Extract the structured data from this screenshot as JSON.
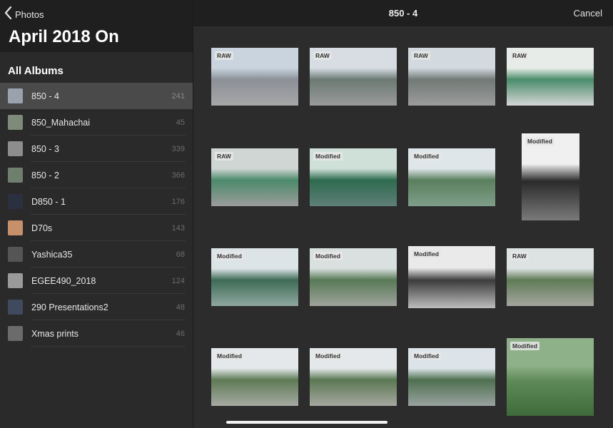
{
  "nav": {
    "back_label": "Photos",
    "album_title": "April 2018 On",
    "section_title": "All Albums"
  },
  "albums": [
    {
      "name": "850 - 4",
      "count": "241",
      "selected": true,
      "thumb_color": "#9aa3ad"
    },
    {
      "name": "850_Mahachai",
      "count": "45",
      "thumb_color": "#7f8b7a"
    },
    {
      "name": "850 - 3",
      "count": "339",
      "thumb_color": "#8d8d8d"
    },
    {
      "name": "850 - 2",
      "count": "366",
      "thumb_color": "#6f7f6e"
    },
    {
      "name": "D850 - 1",
      "count": "176",
      "thumb_color": "#2a3040"
    },
    {
      "name": "D70s",
      "count": "143",
      "thumb_color": "#c7906a"
    },
    {
      "name": "Yashica35",
      "count": "68",
      "thumb_color": "#555555"
    },
    {
      "name": "EGEE490_2018",
      "count": "124",
      "thumb_color": "#9a9a9a"
    },
    {
      "name": "290 Presentations2",
      "count": "48",
      "thumb_color": "#3f4a5e"
    },
    {
      "name": "Xmas prints",
      "count": "46",
      "thumb_color": "#6b6b6b"
    }
  ],
  "content": {
    "title": "850 - 4",
    "cancel_label": "Cancel"
  },
  "photos": [
    {
      "badge": "RAW",
      "colors": [
        "#c9d4df",
        "#8c9097",
        "#a7a7a7"
      ]
    },
    {
      "badge": "RAW",
      "colors": [
        "#d7dde3",
        "#6c7a74",
        "#9a9a9a"
      ]
    },
    {
      "badge": "RAW",
      "colors": [
        "#d2d9df",
        "#717a76",
        "#9c9c9c"
      ]
    },
    {
      "badge": "RAW",
      "colors": [
        "#e7ece8",
        "#4a8c6b",
        "#d6d6d6"
      ]
    },
    {
      "badge": "RAW",
      "colors": [
        "#cfd6d3",
        "#4b8a6a",
        "#9c9c9c"
      ]
    },
    {
      "badge": "Modified",
      "colors": [
        "#cfe0d9",
        "#2e6b4f",
        "#5f7f78"
      ]
    },
    {
      "badge": "Modified",
      "colors": [
        "#dfe6ea",
        "#5a7f5d",
        "#7f9e8a"
      ]
    },
    {
      "badge": "Modified",
      "colors": [
        "#f0f0f0",
        "#2a2a2a",
        "#7a7a7a"
      ]
    },
    {
      "badge": "Modified",
      "colors": [
        "#dde4e8",
        "#3e6b56",
        "#8fa7a0"
      ]
    },
    {
      "badge": "Modified",
      "colors": [
        "#d9e0df",
        "#587a56",
        "#9fa39c"
      ]
    },
    {
      "badge": "Modified",
      "colors": [
        "#eaeaea",
        "#3c3c3c",
        "#bdbdbd"
      ]
    },
    {
      "badge": "RAW",
      "colors": [
        "#dde2e3",
        "#5f7b57",
        "#a5a69e"
      ]
    },
    {
      "badge": "Modified",
      "colors": [
        "#e4e8ea",
        "#5d7a55",
        "#a8aaa3"
      ]
    },
    {
      "badge": "Modified",
      "colors": [
        "#e4e8ea",
        "#5a7853",
        "#a7a7a0"
      ]
    },
    {
      "badge": "Modified",
      "colors": [
        "#dce4ea",
        "#4f7050",
        "#9aa2a1"
      ]
    },
    {
      "badge": "Modified",
      "colors": [
        "#8fb189",
        "#5e8a58",
        "#3f6a3a"
      ]
    }
  ]
}
